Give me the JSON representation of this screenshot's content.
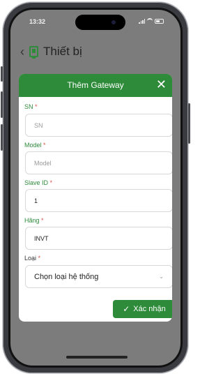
{
  "status_bar": {
    "time": "13:32"
  },
  "header": {
    "back_icon": "chevron-left-icon",
    "title": "Thiết bị"
  },
  "modal": {
    "title": "Thêm Gateway",
    "close_icon": "close-icon",
    "fields": [
      {
        "label": "SN",
        "required": "*",
        "placeholder": "SN",
        "value": ""
      },
      {
        "label": "Model",
        "required": "*",
        "placeholder": "Model",
        "value": ""
      },
      {
        "label": "Slave ID",
        "required": "*",
        "value": "1"
      },
      {
        "label": "Hãng",
        "required": "*",
        "value": "INVT"
      },
      {
        "label": "Loại",
        "required": "*",
        "selected": "Chọn loại hệ thống"
      }
    ],
    "confirm_label": "Xác nhận"
  },
  "colors": {
    "accent": "#2e8b3a",
    "required": "#d9534f"
  }
}
